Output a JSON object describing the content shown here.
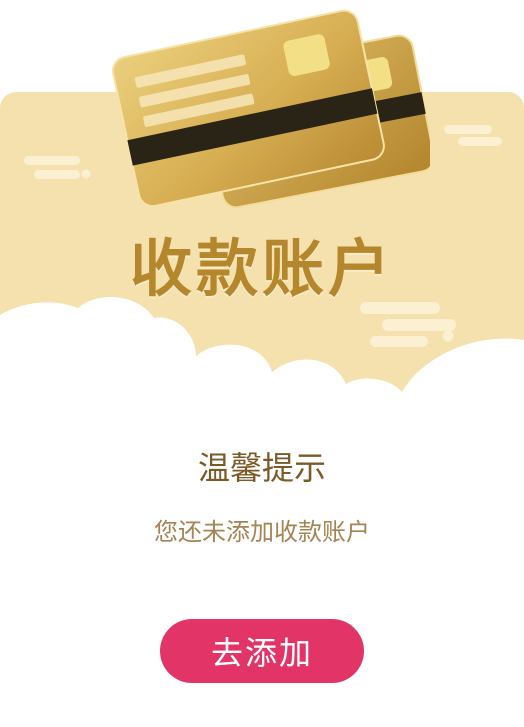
{
  "header": {
    "title": "收款账户"
  },
  "tip": {
    "title": "温馨提示",
    "message": "您还未添加收款账户"
  },
  "actions": {
    "add_label": "去添加"
  },
  "icons": {
    "illustration": "bank-card-icon"
  },
  "colors": {
    "header_background": "#f5e1ae",
    "title": "#b5872c",
    "button": "#e23466",
    "tip_title": "#7b5a27",
    "tip_message": "#a48453"
  }
}
